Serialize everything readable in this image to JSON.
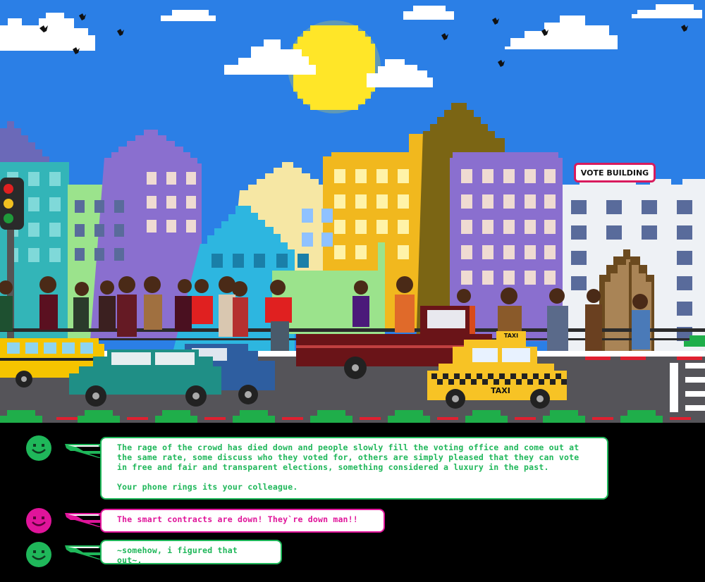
{
  "scene": {
    "sign_text": "VOTE BUILDING",
    "taxi_roof_text": "TAXI",
    "taxi_door_text": "TAXI",
    "colors": {
      "sky": "#2b7fe6",
      "sun": "#ffe628",
      "road": "#555459",
      "grass": "#1fae4a",
      "school_bus": "#f5c400",
      "taxi": "#f7c325"
    },
    "icons": [
      "traffic-light-icon",
      "bird-icon",
      "sun-icon",
      "cloud-icon"
    ]
  },
  "chat": {
    "messages": [
      {
        "speaker_color": "#1fb75a",
        "paragraphs": [
          "The rage of the crowd has died down and people slowly fill the voting office and come out at the same rate, some discuss who they voted for, others are simply pleased that they can vote in free and fair and transparent elections, something considered a luxury in the past.",
          "Your phone rings its your colleague."
        ]
      },
      {
        "speaker_color": "#e0149a",
        "paragraphs": [
          "The smart contracts are down! They`re down man!!"
        ]
      },
      {
        "speaker_color": "#1fb75a",
        "paragraphs": [
          "~somehow, i figured that out~."
        ]
      }
    ]
  }
}
